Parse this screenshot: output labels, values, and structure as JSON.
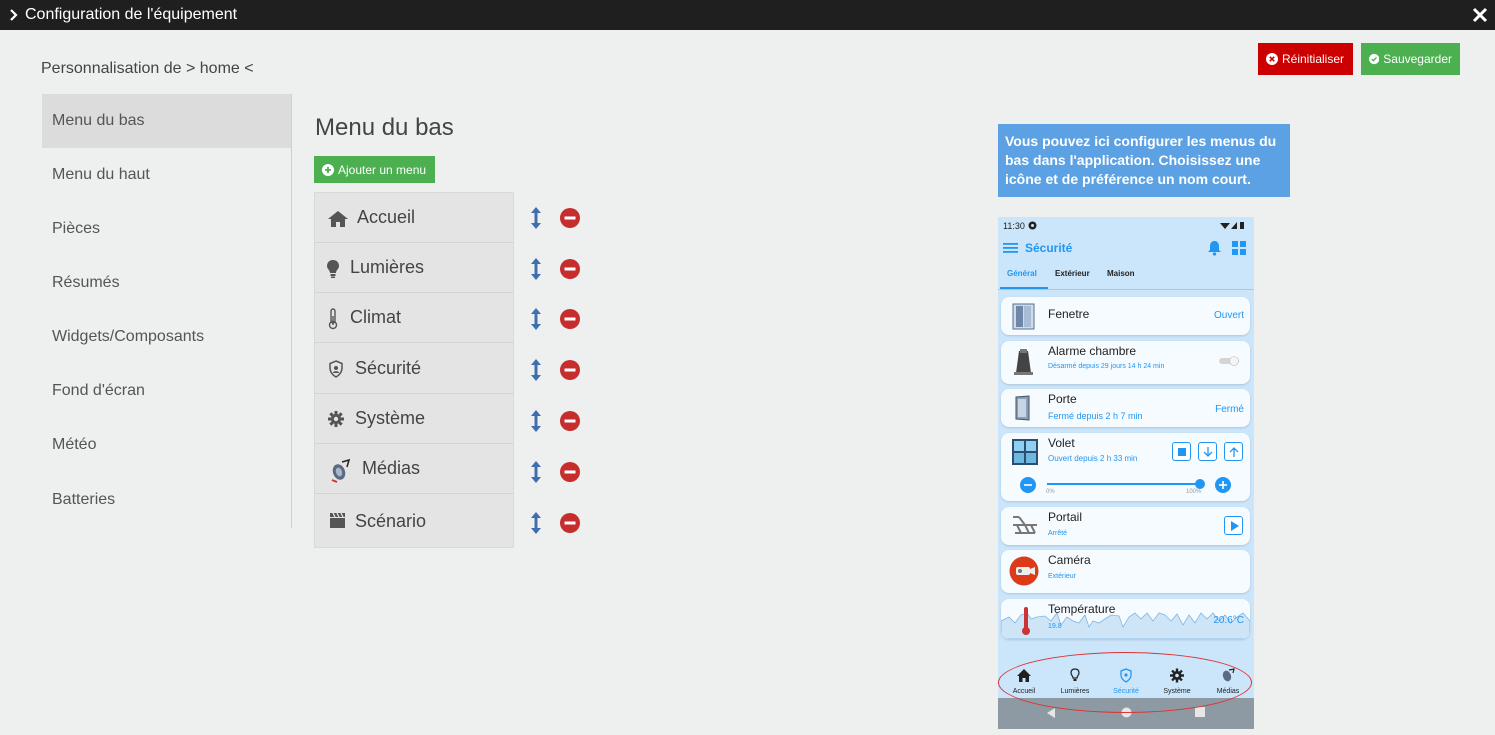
{
  "window": {
    "title": "Configuration de l'équipement"
  },
  "breadcrumb": "Personnalisation de > home <",
  "toolbar": {
    "reset_label": "Réinitialiser",
    "save_label": "Sauvegarder"
  },
  "sidebar": {
    "items": [
      {
        "label": "Menu du bas",
        "active": true
      },
      {
        "label": "Menu du haut"
      },
      {
        "label": "Pièces"
      },
      {
        "label": "Résumés"
      },
      {
        "label": "Widgets/Composants"
      },
      {
        "label": "Fond d'écran"
      },
      {
        "label": "Météo"
      },
      {
        "label": "Batteries"
      }
    ]
  },
  "main": {
    "title": "Menu du bas",
    "add_label": "Ajouter un menu",
    "menus": [
      {
        "label": "Accueil",
        "icon": "home-icon"
      },
      {
        "label": "Lumières",
        "icon": "lightbulb-icon"
      },
      {
        "label": "Climat",
        "icon": "thermometer-icon"
      },
      {
        "label": "Sécurité",
        "icon": "shield-icon"
      },
      {
        "label": "Système",
        "icon": "gear-icon"
      },
      {
        "label": "Médias",
        "icon": "media-icon"
      },
      {
        "label": "Scénario",
        "icon": "clapperboard-icon"
      }
    ]
  },
  "info": {
    "text": "Vous pouvez ici configurer les menus du bas dans l'application. Choisissez une icône et de préférence un nom court."
  },
  "phone": {
    "time": "11:30",
    "title": "Sécurité",
    "tabs": [
      "Général",
      "Extérieur",
      "Maison"
    ],
    "cards": {
      "fenetre": {
        "name": "Fenetre",
        "state": "Ouvert"
      },
      "alarme": {
        "name": "Alarme chambre",
        "sub": "Désarmé depuis 29 jours 14 h 24 min"
      },
      "porte": {
        "name": "Porte",
        "sub": "Fermé depuis 2 h 7 min",
        "state": "Fermé"
      },
      "volet": {
        "name": "Volet",
        "sub": "Ouvert depuis 2 h 33 min",
        "min": "0%",
        "max": "100%",
        "level": 100
      },
      "portail": {
        "name": "Portail",
        "sub": "Arrêté"
      },
      "camera": {
        "name": "Caméra",
        "sub": "Extérieur"
      },
      "temperature": {
        "name": "Température",
        "low": "19.8",
        "value": "20.6°C"
      }
    },
    "bottom_nav": [
      "Accueil",
      "Lumières",
      "Sécurité",
      "Système",
      "Médias"
    ]
  },
  "colors": {
    "accent": "#2196f3",
    "danger": "#cc0000",
    "success": "#4caf50",
    "info": "#5ba1e3"
  }
}
